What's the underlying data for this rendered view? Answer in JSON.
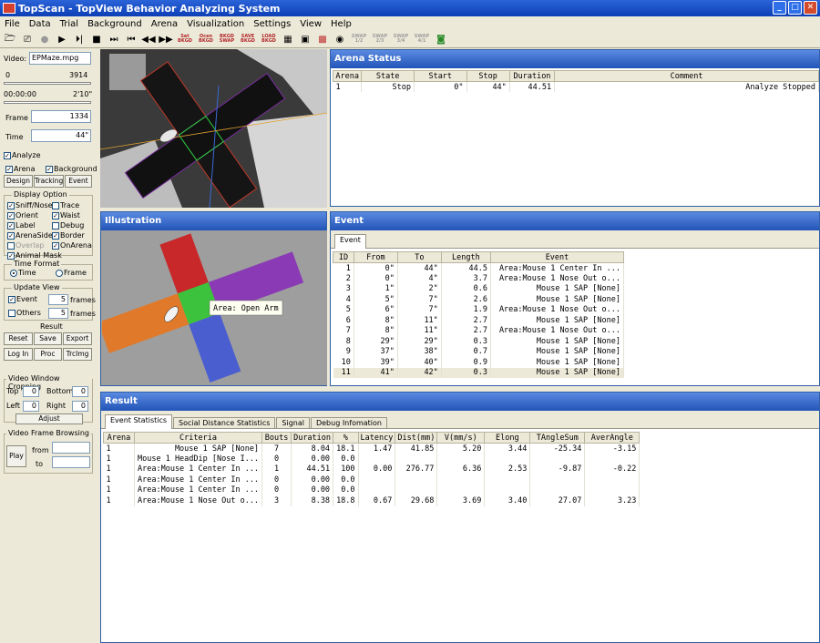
{
  "window": {
    "title": "TopScan - TopView Behavior Analyzing System"
  },
  "menu": [
    "File",
    "Data",
    "Trial",
    "Background",
    "Arena",
    "Visualization",
    "Settings",
    "View",
    "Help"
  ],
  "toolbar": {
    "text_buttons": [
      "Set BKGD",
      "Ocen BKGD",
      "BKGD SWAP",
      "SAVE BKGD",
      "LOAD BKGD"
    ],
    "grey_buttons": [
      "SWAP 1/2",
      "SWAP 2/3",
      "SWAP 3/4",
      "SWAP 4/1"
    ]
  },
  "left": {
    "video_label": "Video:",
    "video_file": "EPMaze.mpg",
    "range_start": "0",
    "range_end": "3914",
    "time_start": "00:00:00",
    "time_end": "2'10\"",
    "frame_label": "Frame",
    "frame_value": "1334",
    "time_label": "Time",
    "time_value": "44\"",
    "analyze": "Analyze",
    "arena": "Arena",
    "background": "Background",
    "design": "Design",
    "tracking": "Tracking",
    "event": "Event",
    "display_option": "Display Option",
    "display_items": [
      "Sniff/Nose",
      "Trace",
      "Orient",
      "Waist",
      "Label",
      "Debug",
      "ArenaSide",
      "Border",
      "Overlap",
      "OnArena",
      "Animal Mask"
    ],
    "time_format": "Time Format",
    "time_opt": "Time",
    "frame_opt": "Frame",
    "update_view": "Update View",
    "uv_event": "Event",
    "uv_event_val": "5",
    "uv_others": "Others",
    "uv_others_val": "5",
    "frames": "frames",
    "result": "Result",
    "reset": "Reset",
    "save": "Save",
    "export": "Export",
    "login": "Log In",
    "proc": "Proc",
    "trcimg": "TrcImg",
    "cropping": "Video Window Cropping",
    "top": "Top",
    "top_val": "0",
    "bottom": "Bottom",
    "bottom_val": "0",
    "leftl": "Left",
    "left_val": "0",
    "right": "Right",
    "right_val": "0",
    "adjust": "Adjust",
    "browsing": "Video Frame Browsing",
    "play": "Play",
    "from": "from",
    "to": "to"
  },
  "arena_status": {
    "title": "Arena Status",
    "headers": [
      "Arena",
      "State",
      "Start",
      "Stop",
      "Duration",
      "Comment"
    ],
    "rows": [
      [
        "1",
        "Stop",
        "0\"",
        "44\"",
        "44.51",
        "Analyze Stopped"
      ]
    ]
  },
  "illustration": {
    "title": "Illustration",
    "tooltip": "Area: Open Arm"
  },
  "event": {
    "title": "Event",
    "tab": "Event",
    "headers": [
      "ID",
      "From",
      "To",
      "Length",
      "Event"
    ],
    "rows": [
      [
        "1",
        "0\"",
        "44\"",
        "44.5",
        "Area:Mouse 1 Center In ..."
      ],
      [
        "2",
        "0\"",
        "4\"",
        "3.7",
        "Area:Mouse 1 Nose Out o..."
      ],
      [
        "3",
        "1\"",
        "2\"",
        "0.6",
        "Mouse 1 SAP [None]"
      ],
      [
        "4",
        "5\"",
        "7\"",
        "2.6",
        "Mouse 1 SAP [None]"
      ],
      [
        "5",
        "6\"",
        "7\"",
        "1.9",
        "Area:Mouse 1 Nose Out o..."
      ],
      [
        "6",
        "8\"",
        "11\"",
        "2.7",
        "Mouse 1 SAP [None]"
      ],
      [
        "7",
        "8\"",
        "11\"",
        "2.7",
        "Area:Mouse 1 Nose Out o..."
      ],
      [
        "8",
        "29\"",
        "29\"",
        "0.3",
        "Mouse 1 SAP [None]"
      ],
      [
        "9",
        "37\"",
        "38\"",
        "0.7",
        "Mouse 1 SAP [None]"
      ],
      [
        "10",
        "39\"",
        "40\"",
        "0.9",
        "Mouse 1 SAP [None]"
      ],
      [
        "11",
        "41\"",
        "42\"",
        "0.3",
        "Mouse 1 SAP [None]"
      ]
    ]
  },
  "result": {
    "title": "Result",
    "tabs": [
      "Event Statistics",
      "Social Distance Statistics",
      "Signal",
      "Debug Infomation"
    ],
    "headers": [
      "Arena",
      "Criteria",
      "Bouts",
      "Duration",
      "%",
      "Latency",
      "Dist(mm)",
      "V(mm/s)",
      "Elong",
      "TAngleSum",
      "AverAngle"
    ],
    "rows": [
      [
        "1",
        "Mouse 1 SAP [None]",
        "7",
        "8.04",
        "18.1",
        "1.47",
        "41.85",
        "5.20",
        "3.44",
        "-25.34",
        "-3.15"
      ],
      [
        "1",
        "Mouse 1 HeadDip [Nose I...",
        "0",
        "0.00",
        "0.0",
        "",
        "",
        "",
        "",
        "",
        ""
      ],
      [
        "1",
        "Area:Mouse 1 Center In ...",
        "1",
        "44.51",
        "100",
        "0.00",
        "276.77",
        "6.36",
        "2.53",
        "-9.87",
        "-0.22"
      ],
      [
        "1",
        "Area:Mouse 1 Center In ...",
        "0",
        "0.00",
        "0.0",
        "",
        "",
        "",
        "",
        "",
        ""
      ],
      [
        "1",
        "Area:Mouse 1 Center In ...",
        "0",
        "0.00",
        "0.0",
        "",
        "",
        "",
        "",
        "",
        ""
      ],
      [
        "1",
        "Area:Mouse 1 Nose Out o...",
        "3",
        "8.38",
        "18.8",
        "0.67",
        "29.68",
        "3.69",
        "3.40",
        "27.07",
        "3.23"
      ]
    ]
  }
}
